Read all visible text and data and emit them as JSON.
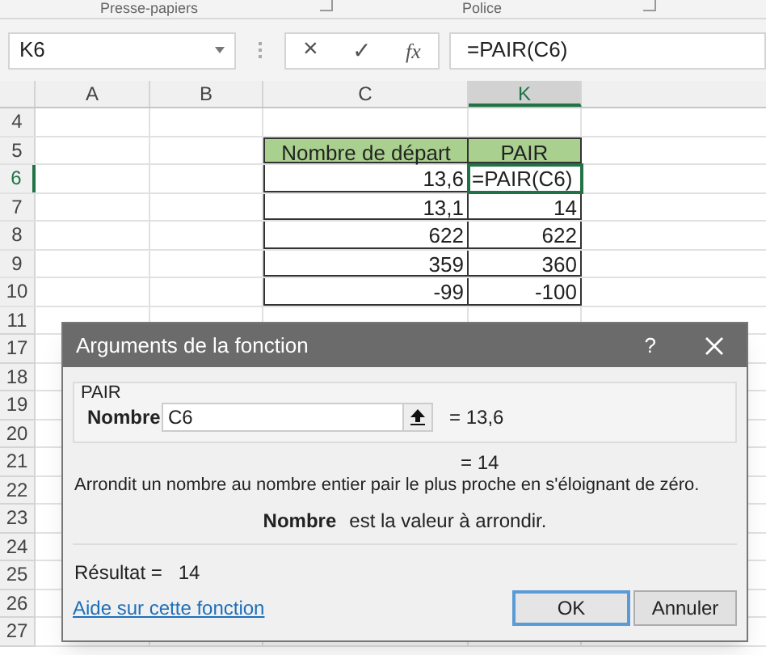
{
  "ribbon_groups": [
    {
      "label": "Presse-papiers"
    },
    {
      "label": "Police"
    }
  ],
  "formula_bar": {
    "name_box": "K6",
    "cancel": "×",
    "enter": "✓",
    "fx": "fx",
    "formula": "=PAIR(C6)"
  },
  "columns": [
    {
      "label": "A",
      "selected": false
    },
    {
      "label": "B",
      "selected": false
    },
    {
      "label": "C",
      "selected": false
    },
    {
      "label": "K",
      "selected": true
    }
  ],
  "rows": [
    {
      "number": "4",
      "selected": false,
      "cells": [
        {
          "text": ""
        },
        {
          "text": ""
        },
        {
          "text": "",
          "kind": "plain"
        },
        {
          "text": "",
          "kind": "plain"
        }
      ]
    },
    {
      "number": "5",
      "selected": false,
      "cells": [
        {
          "text": ""
        },
        {
          "text": ""
        },
        {
          "text": "Nombre de départ",
          "kind": "header"
        },
        {
          "text": "PAIR",
          "kind": "header"
        }
      ]
    },
    {
      "number": "6",
      "selected": true,
      "cells": [
        {
          "text": ""
        },
        {
          "text": ""
        },
        {
          "text": "13,6",
          "kind": "number"
        },
        {
          "text": "=PAIR(C6)",
          "kind": "formula",
          "selected": true
        }
      ]
    },
    {
      "number": "7",
      "selected": false,
      "cells": [
        {
          "text": ""
        },
        {
          "text": ""
        },
        {
          "text": "13,1",
          "kind": "number"
        },
        {
          "text": "14",
          "kind": "number"
        }
      ]
    },
    {
      "number": "8",
      "selected": false,
      "cells": [
        {
          "text": ""
        },
        {
          "text": ""
        },
        {
          "text": "622",
          "kind": "number"
        },
        {
          "text": "622",
          "kind": "number"
        }
      ]
    },
    {
      "number": "9",
      "selected": false,
      "cells": [
        {
          "text": ""
        },
        {
          "text": ""
        },
        {
          "text": "359",
          "kind": "number"
        },
        {
          "text": "360",
          "kind": "number"
        }
      ]
    },
    {
      "number": "10",
      "selected": false,
      "cells": [
        {
          "text": ""
        },
        {
          "text": ""
        },
        {
          "text": "-99",
          "kind": "number"
        },
        {
          "text": "-100",
          "kind": "number"
        }
      ]
    }
  ],
  "lower_row_numbers": [
    "11",
    "17",
    "18",
    "19",
    "20",
    "21",
    "22",
    "23",
    "24",
    "25",
    "26",
    "27"
  ],
  "dialog": {
    "title": "Arguments de la fonction",
    "help": "?",
    "function_name": "PAIR",
    "argument_label": "Nombre",
    "argument_value": "C6",
    "argument_result": "= 13,6",
    "formula_result": "= 14",
    "description": "Arrondit un nombre au nombre entier pair le plus proche en s'éloignant de zéro.",
    "argument_help_label": "Nombre",
    "argument_help": "est la valeur à arrondir.",
    "result_label": "Résultat =",
    "result_value": "14",
    "help_link": "Aide sur cette fonction",
    "buttons": [
      {
        "label": "OK",
        "kind": "default"
      },
      {
        "label": "Annuler",
        "kind": "normal"
      }
    ]
  }
}
